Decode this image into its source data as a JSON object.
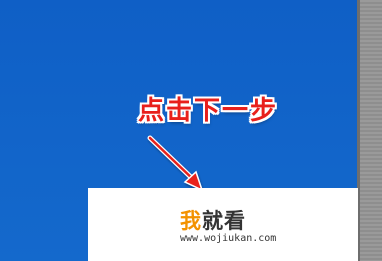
{
  "annotation": {
    "text": "点击下一步",
    "color": "#e8201c"
  },
  "watermark": {
    "logo_first_char": "我",
    "logo_rest": "就看",
    "url": "www.wojiukan.com",
    "accent": "#f39200"
  },
  "colors": {
    "background": "#1466c8",
    "scrollbar": "#8c8c8c"
  },
  "icons": {
    "arrow": "annotation-arrow-icon"
  }
}
